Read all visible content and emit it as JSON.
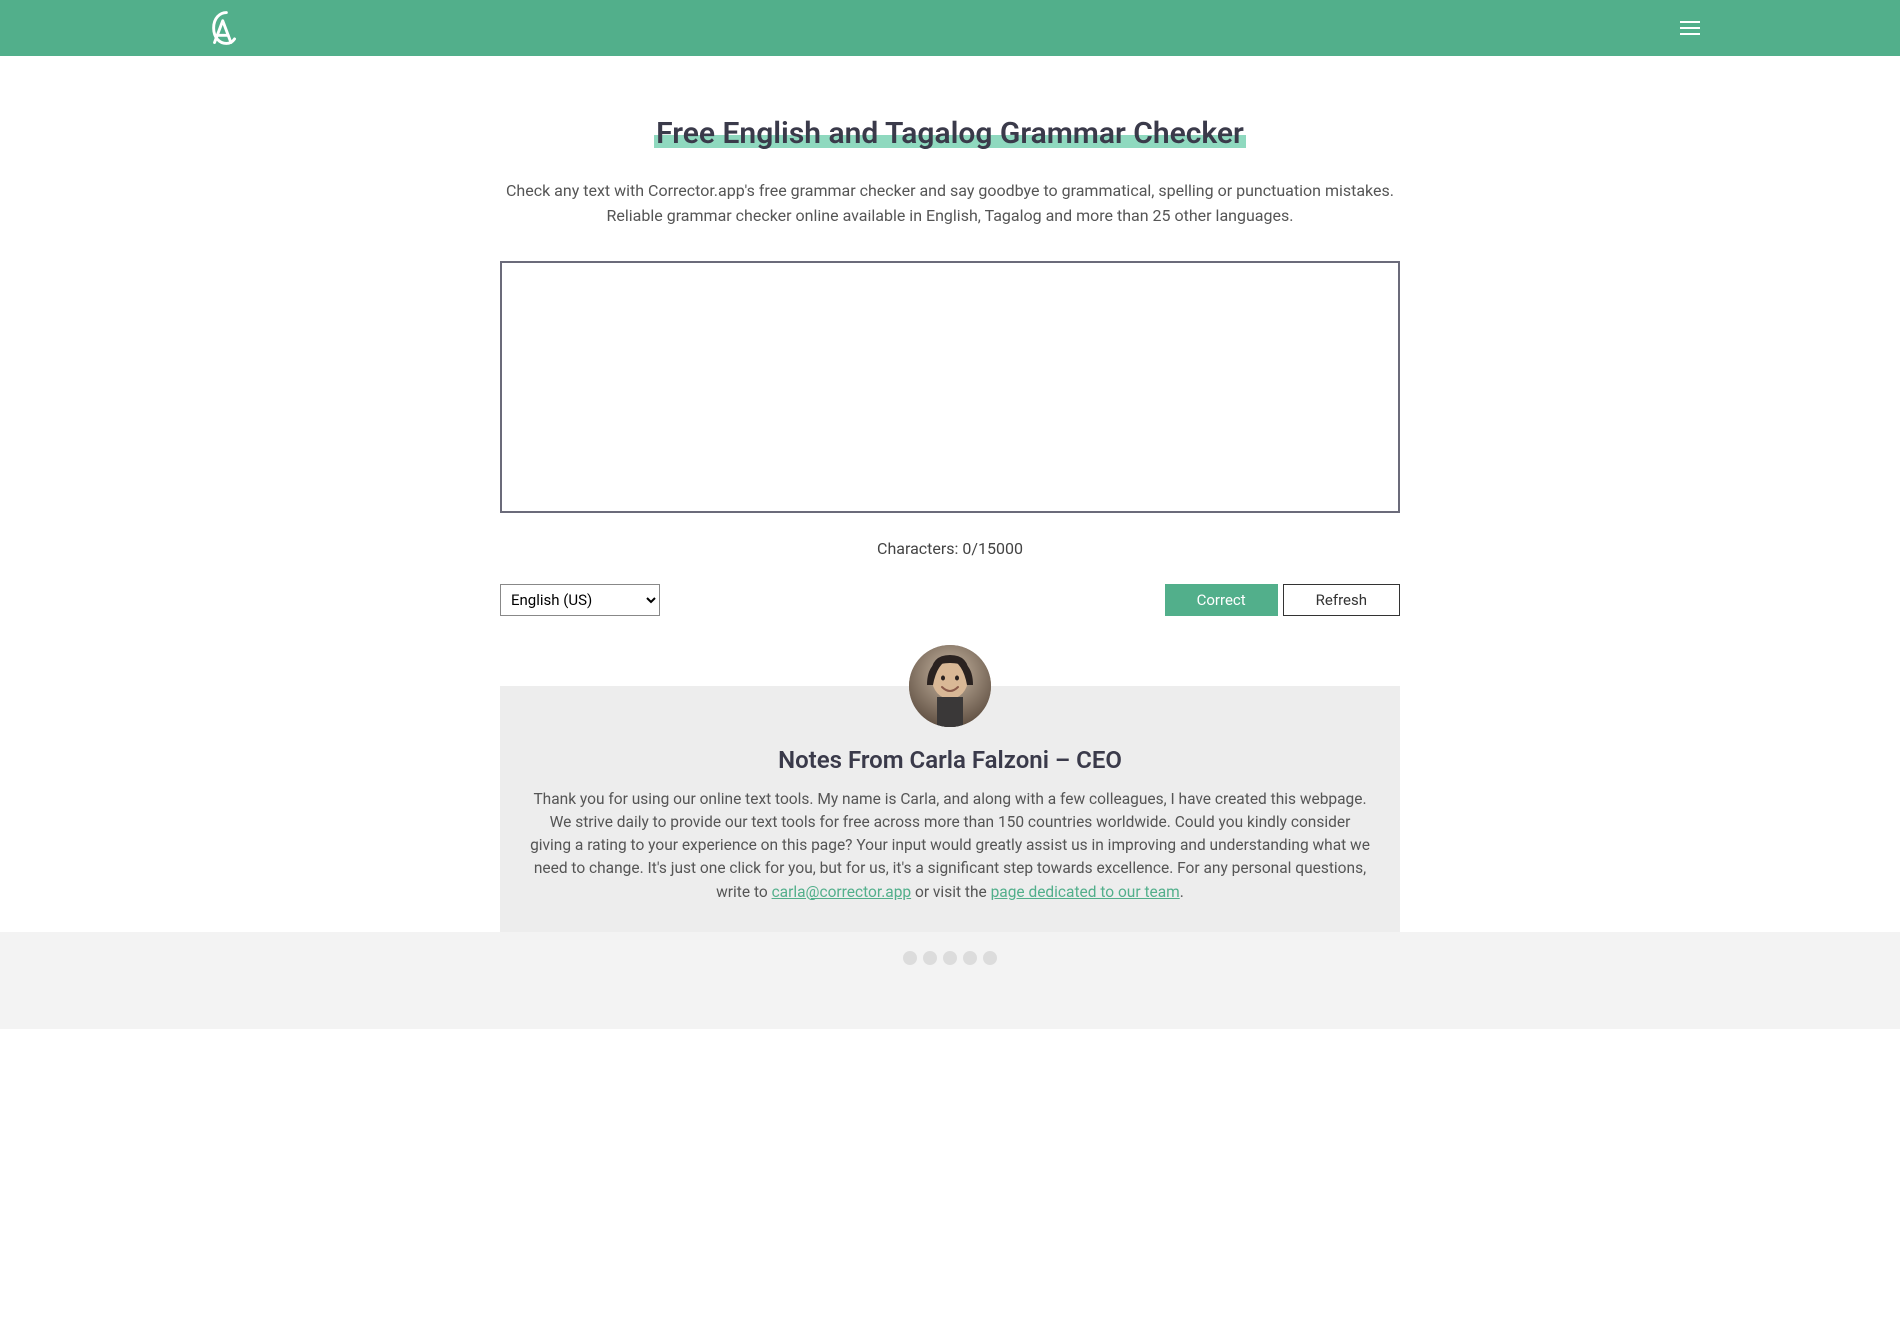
{
  "header": {
    "logo_text": "CA"
  },
  "main": {
    "title": "Free English and Tagalog Grammar Checker",
    "subtitle": "Check any text with Corrector.app's free grammar checker and say goodbye to grammatical, spelling or punctuation mistakes. Reliable grammar checker online available in English, Tagalog and more than 25 other languages.",
    "textarea_value": "",
    "char_counter": "Characters: 0/15000",
    "language_selected": "English (US)",
    "buttons": {
      "correct": "Correct",
      "refresh": "Refresh"
    }
  },
  "notes": {
    "title": "Notes From Carla Falzoni – CEO",
    "body_part1": "Thank you for using our online text tools. My name is Carla, and along with a few colleagues, I have created this webpage. We strive daily to provide our text tools for free across more than 150 countries worldwide. Could you kindly consider giving a rating to your experience on this page? Your input would greatly assist us in improving and understanding what we need to change. It's just one click for you, but for us, it's a significant step towards excellence. For any personal questions, write to ",
    "email_link": "carla@corrector.app",
    "body_part2": " or visit the ",
    "team_link": "page dedicated to our team",
    "body_part3": "."
  }
}
